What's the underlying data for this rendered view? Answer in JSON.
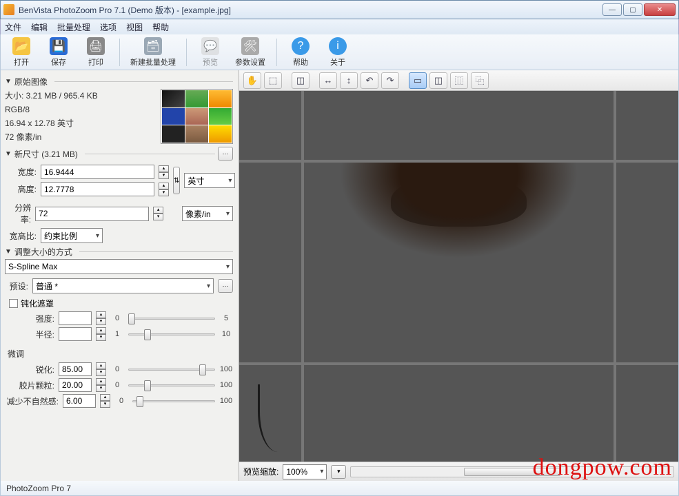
{
  "window": {
    "title": "BenVista PhotoZoom Pro 7.1 (Demo 版本) - [example.jpg]"
  },
  "menu": [
    "文件",
    "编辑",
    "批量处理",
    "选项",
    "视图",
    "帮助"
  ],
  "toolbar": [
    {
      "id": "open",
      "label": "打开",
      "color": "#f5c542"
    },
    {
      "id": "save",
      "label": "保存",
      "color": "#2a6bd4"
    },
    {
      "id": "print",
      "label": "打印",
      "color": "#555"
    },
    {
      "id": "sep"
    },
    {
      "id": "batch",
      "label": "新建批量处理",
      "color": "#9aa8b5"
    },
    {
      "id": "sep"
    },
    {
      "id": "preview",
      "label": "预览",
      "color": "#cfcfcf",
      "disabled": true
    },
    {
      "id": "params",
      "label": "参数设置",
      "color": "#8a8a8a"
    },
    {
      "id": "sep"
    },
    {
      "id": "help",
      "label": "帮助",
      "color": "#2a8ad4"
    },
    {
      "id": "about",
      "label": "关于",
      "color": "#2a8ad4"
    }
  ],
  "sections": {
    "original": {
      "title": "原始图像",
      "size_line": "大小: 3.21 MB / 965.4 KB",
      "mode": "RGB/8",
      "dims": "16.94 x 12.78 英寸",
      "res": "72 像素/in"
    },
    "newsize": {
      "title": "新尺寸 (3.21 MB)",
      "width_label": "宽度:",
      "width_value": "16.9444",
      "height_label": "高度:",
      "height_value": "12.7778",
      "unit": "英寸",
      "res_label": "分辨率:",
      "res_value": "72",
      "res_unit": "像素/in",
      "aspect_label": "宽高比:",
      "aspect_value": "约束比例"
    },
    "method": {
      "title": "调整大小的方式",
      "algo": "S-Spline Max",
      "preset_label": "预设:",
      "preset_value": "普通 *"
    },
    "unsharp": {
      "checkbox": "钝化遮罩",
      "strength_label": "强度:",
      "strength_value": "",
      "strength_min": "0",
      "strength_max": "5",
      "radius_label": "半径:",
      "radius_value": "",
      "radius_min": "1",
      "radius_max": "10"
    },
    "finetune": {
      "title": "微调",
      "sharp_label": "锐化:",
      "sharp_value": "85.00",
      "sharp_min": "0",
      "sharp_max": "100",
      "grain_label": "胶片颗粒:",
      "grain_value": "20.00",
      "grain_min": "0",
      "grain_max": "100",
      "artifact_label": "减少不自然感:",
      "artifact_value": "6.00",
      "artifact_min": "0",
      "artifact_max": "100"
    }
  },
  "preview_bottom": {
    "zoom_label": "预览缩放:",
    "zoom_value": "100%"
  },
  "status": "PhotoZoom Pro 7",
  "watermark": "dongpow.com"
}
